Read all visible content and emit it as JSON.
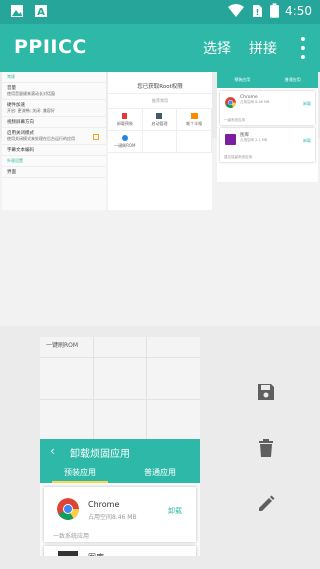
{
  "status_bar": {
    "time": "4:50"
  },
  "toolbar": {
    "title": "PPIICC",
    "select_label": "选择",
    "splice_label": "拼接"
  },
  "thumbs": {
    "settings": {
      "rows": [
        {
          "kind": "hdr",
          "text": "常规"
        },
        {
          "kind": "b",
          "text": "音量"
        },
        {
          "kind": "s",
          "text": "使用音量键来滚动长对话窗"
        },
        {
          "kind": "b",
          "text": "硬件加速"
        },
        {
          "kind": "s",
          "text": "开启: 更流畅; 关闭: 兼容好"
        },
        {
          "kind": "b",
          "text": "视频屏幕方向"
        },
        {
          "kind": "b",
          "text": "启用关闭模式"
        },
        {
          "kind": "s",
          "text": "使用关闭模式来处理在后台运行的应用"
        },
        {
          "kind": "b",
          "text": "字幕文本编码"
        },
        {
          "kind": "hdr",
          "text": "外观设置"
        },
        {
          "kind": "b",
          "text": "界面"
        }
      ]
    },
    "root": {
      "title": "您已获取Root权限",
      "tag": "推荐常用",
      "cells": [
        "卸载预装",
        "启动管理",
        "耗个半格",
        "一键刷ROM",
        "",
        ""
      ]
    },
    "apps": {
      "tab1": "预装应用",
      "tab2": "普通应用",
      "app1": {
        "name": "Chrome",
        "sub": "占用空间 8.46 MB",
        "uninstall": "卸载"
      },
      "app2": {
        "name": "图库",
        "sub": "占用空间 2.1 MB",
        "uninstall": "卸载"
      },
      "foot1": "一级系统应用",
      "foot2": "建议保留系统应用"
    }
  },
  "lower_grid": {
    "text": "一键刷ROM"
  },
  "bigshot": {
    "title": "卸载烦固应用",
    "tab_preinstalled": "预装应用",
    "tab_normal": "普通应用",
    "app_name": "Chrome",
    "app_size": "占用空间8.46 MB",
    "uninstall": "卸载",
    "foot": "一致系统应用",
    "app2_name": "图库"
  },
  "colors": {
    "accent": "#2db8a8",
    "status": "#26a69a",
    "indicator": "#ffd54f"
  },
  "icons": [
    "save-icon",
    "trash-icon",
    "pencil-icon"
  ]
}
